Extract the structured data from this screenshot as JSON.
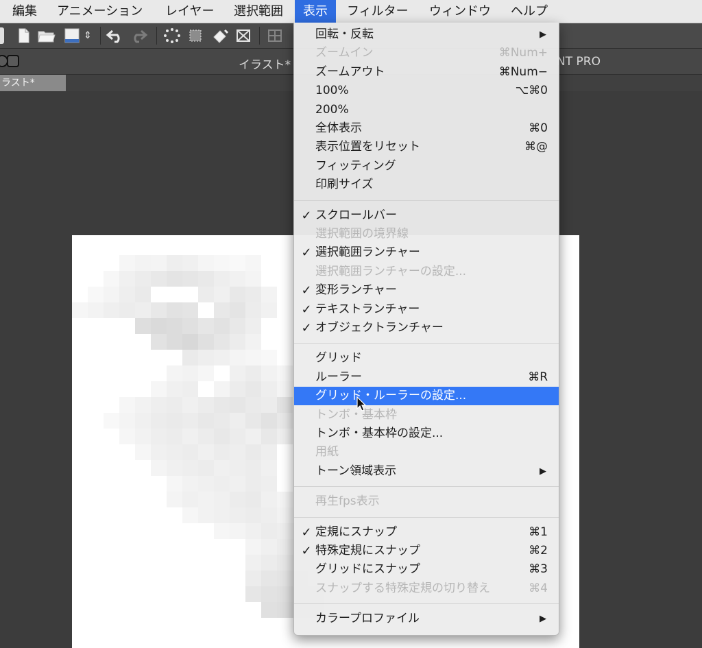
{
  "menubar": {
    "items": [
      "編集",
      "アニメーション",
      "レイヤー",
      "選択範囲",
      "表示",
      "フィルター",
      "ウィンドウ",
      "ヘルプ"
    ],
    "active": "表示"
  },
  "toolbar": {
    "icons": [
      "new-file-icon",
      "open-folder-icon",
      "save-icon",
      "undo-icon",
      "redo-icon",
      "select-icon",
      "transform-icon",
      "fill-icon",
      "mesh-icon",
      "grid-icon"
    ]
  },
  "window": {
    "title": "イラスト*",
    "app_name_partial": "NT PRO",
    "tab_label": "ラスト*"
  },
  "view_menu": {
    "groups": [
      [
        {
          "label": "回転・反転",
          "checked": false,
          "disabled": false,
          "shortcut": "",
          "submenu": true
        },
        {
          "label": "ズームイン",
          "checked": false,
          "disabled": true,
          "shortcut": "⌘Num+",
          "submenu": false
        },
        {
          "label": "ズームアウト",
          "checked": false,
          "disabled": false,
          "shortcut": "⌘Num−",
          "submenu": false
        },
        {
          "label": "100%",
          "checked": false,
          "disabled": false,
          "shortcut": "⌥⌘0",
          "submenu": false
        },
        {
          "label": "200%",
          "checked": false,
          "disabled": false,
          "shortcut": "",
          "submenu": false
        },
        {
          "label": "全体表示",
          "checked": false,
          "disabled": false,
          "shortcut": "⌘0",
          "submenu": false
        },
        {
          "label": "表示位置をリセット",
          "checked": false,
          "disabled": false,
          "shortcut": "⌘@",
          "submenu": false
        },
        {
          "label": "フィッティング",
          "checked": false,
          "disabled": false,
          "shortcut": "",
          "submenu": false
        },
        {
          "label": "印刷サイズ",
          "checked": false,
          "disabled": false,
          "shortcut": "",
          "submenu": false
        }
      ],
      [
        {
          "label": "スクロールバー",
          "checked": true,
          "disabled": false,
          "shortcut": "",
          "submenu": false
        },
        {
          "label": "選択範囲の境界線",
          "checked": false,
          "disabled": true,
          "shortcut": "",
          "submenu": false
        },
        {
          "label": "選択範囲ランチャー",
          "checked": true,
          "disabled": false,
          "shortcut": "",
          "submenu": false
        },
        {
          "label": "選択範囲ランチャーの設定...",
          "checked": false,
          "disabled": true,
          "shortcut": "",
          "submenu": false
        },
        {
          "label": "変形ランチャー",
          "checked": true,
          "disabled": false,
          "shortcut": "",
          "submenu": false
        },
        {
          "label": "テキストランチャー",
          "checked": true,
          "disabled": false,
          "shortcut": "",
          "submenu": false
        },
        {
          "label": "オブジェクトランチャー",
          "checked": true,
          "disabled": false,
          "shortcut": "",
          "submenu": false
        }
      ],
      [
        {
          "label": "グリッド",
          "checked": false,
          "disabled": false,
          "shortcut": "",
          "submenu": false
        },
        {
          "label": "ルーラー",
          "checked": false,
          "disabled": false,
          "shortcut": "⌘R",
          "submenu": false
        },
        {
          "label": "グリッド・ルーラーの設定...",
          "checked": false,
          "disabled": false,
          "shortcut": "",
          "submenu": false,
          "highlighted": true
        },
        {
          "label": "トンボ・基本枠",
          "checked": false,
          "disabled": true,
          "shortcut": "",
          "submenu": false
        },
        {
          "label": "トンボ・基本枠の設定...",
          "checked": false,
          "disabled": false,
          "shortcut": "",
          "submenu": false
        },
        {
          "label": "用紙",
          "checked": false,
          "disabled": true,
          "shortcut": "",
          "submenu": false
        },
        {
          "label": "トーン領域表示",
          "checked": false,
          "disabled": false,
          "shortcut": "",
          "submenu": true
        }
      ],
      [
        {
          "label": "再生fps表示",
          "checked": false,
          "disabled": true,
          "shortcut": "",
          "submenu": false
        }
      ],
      [
        {
          "label": "定規にスナップ",
          "checked": true,
          "disabled": false,
          "shortcut": "⌘1",
          "submenu": false
        },
        {
          "label": "特殊定規にスナップ",
          "checked": true,
          "disabled": false,
          "shortcut": "⌘2",
          "submenu": false
        },
        {
          "label": "グリッドにスナップ",
          "checked": false,
          "disabled": false,
          "shortcut": "⌘3",
          "submenu": false
        },
        {
          "label": "スナップする特殊定規の切り替え",
          "checked": false,
          "disabled": true,
          "shortcut": "⌘4",
          "submenu": false
        }
      ],
      [
        {
          "label": "カラープロファイル",
          "checked": false,
          "disabled": false,
          "shortcut": "",
          "submenu": true
        }
      ]
    ]
  },
  "colors": {
    "menubar_active": "#2f6de1",
    "menu_highlight": "#3478f6",
    "canvas_bg": "#3c3c3c",
    "disabled_text": "#b6b6b6"
  }
}
